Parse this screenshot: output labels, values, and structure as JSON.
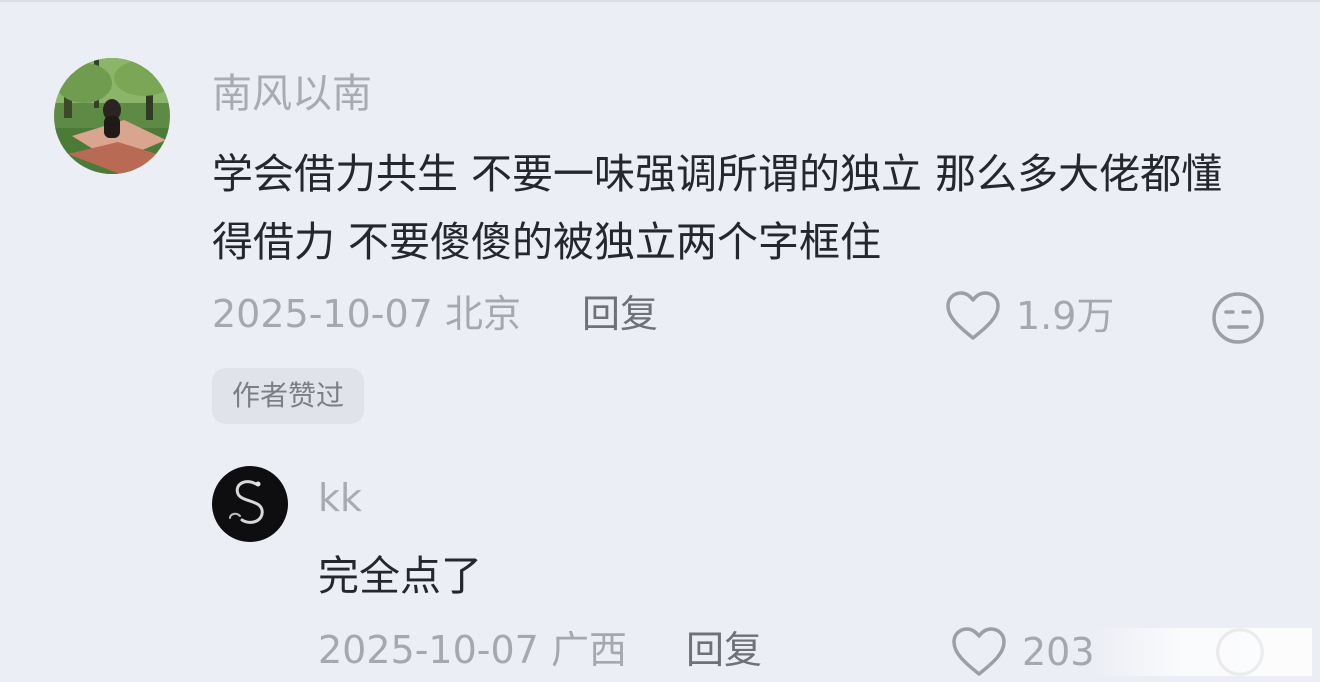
{
  "comment": {
    "author": "南风以南",
    "text": "学会借力共生 不要一味强调所谓的独立 那么多大佬都懂得借力 不要傻傻的被独立两个字框住",
    "date": "2025-10-07",
    "location": "北京",
    "reply_label": "回复",
    "likes": "1.9万",
    "author_liked_badge": "作者赞过",
    "like_icon": "heart-outline-icon",
    "dislike_icon": "neutral-face-icon"
  },
  "reply": {
    "author": "kk",
    "text": "完全点了",
    "date": "2025-10-07",
    "location": "广西",
    "reply_label": "回复",
    "likes": "203",
    "like_icon": "heart-outline-icon",
    "dislike_icon": "neutral-face-icon"
  },
  "colors": {
    "background": "#eceef5",
    "text_primary": "#25272e",
    "text_secondary": "#a6a8b1",
    "reply_link": "#6e707a",
    "badge_bg": "#e1e3ea"
  }
}
